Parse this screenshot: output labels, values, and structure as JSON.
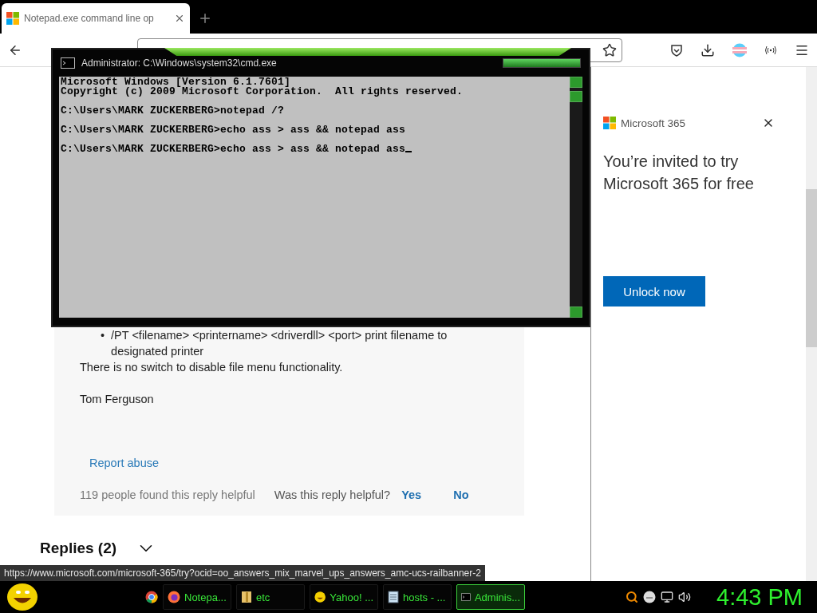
{
  "browser": {
    "tabs": [
      {
        "title": "Notepad.exe command line op",
        "selected": true
      }
    ]
  },
  "console_window": {
    "title": "Administrator: C:\\Windows\\system32\\cmd.exe",
    "cursor_visible": true,
    "blocks": [
      [
        "Microsoft Windows [Version 6.1.7601]",
        "Copyright (c) 2009 Microsoft Corporation.  All rights reserved."
      ],
      [
        "C:\\Users\\MARK ZUCKERBERG>notepad /?"
      ],
      [
        "C:\\Users\\MARK ZUCKERBERG>echo ass > ass && notepad ass"
      ],
      [
        "C:\\Users\\MARK ZUCKERBERG>echo ass > ass && notepad ass"
      ]
    ]
  },
  "answer": {
    "bullets": [
      {
        "marker": "•",
        "text": "/PT <filename> <printername> <driverdll> <port> print filename to designated printer"
      }
    ],
    "paragraph": "There is no switch to disable file menu functionality.",
    "signature": "Tom Ferguson",
    "report_link": "Report abuse",
    "helpful_count": "119 people found this reply helpful",
    "question": "Was this reply helpful?",
    "yes": "Yes",
    "no": "No"
  },
  "replies": {
    "label": "Replies (2)",
    "expanded": false
  },
  "ad": {
    "brand": "Microsoft 365",
    "heading": "You’re invited to try Microsoft 365 for free",
    "button": "Unlock now"
  },
  "status_url": "https://www.microsoft.com/microsoft-365/try?ocid=oo_answers_mix_marvel_ups_answers_amc-ucs-railbanner-2",
  "taskbar": {
    "tasks": [
      {
        "label": "Notepa...",
        "kind": "firefox",
        "selected": false
      },
      {
        "label": "etc",
        "kind": "folder",
        "selected": false
      },
      {
        "label": "Yahoo! ...",
        "kind": "smiley",
        "selected": false
      },
      {
        "label": "hosts - ...",
        "kind": "notepad",
        "selected": false
      },
      {
        "label": "Adminis...",
        "kind": "console",
        "selected": true
      }
    ],
    "clock": "4:43 PM"
  }
}
